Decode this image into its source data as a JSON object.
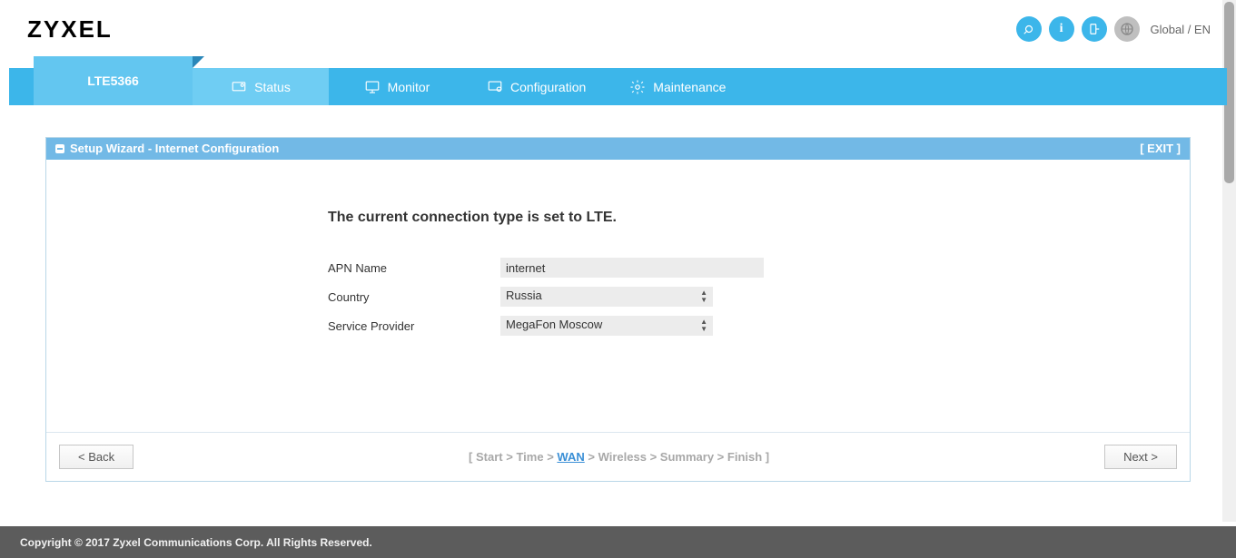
{
  "brand": "ZYXEL",
  "lang_label": "Global / EN",
  "device_tab": "LTE5366",
  "nav": {
    "status": "Status",
    "monitor": "Monitor",
    "configuration": "Configuration",
    "maintenance": "Maintenance"
  },
  "panel": {
    "title": "Setup Wizard - Internet Configuration",
    "exit": "[ EXIT ]"
  },
  "wizard": {
    "heading": "The current connection type is set to LTE.",
    "labels": {
      "apn": "APN Name",
      "country": "Country",
      "provider": "Service Provider"
    },
    "values": {
      "apn": "internet",
      "country": "Russia",
      "provider": "MegaFon Moscow"
    }
  },
  "buttons": {
    "back": "< Back",
    "next": "Next >"
  },
  "breadcrumb": {
    "open": "[ ",
    "close": " ]",
    "sep": " > ",
    "steps": {
      "start": "Start",
      "time": "Time",
      "wan": "WAN",
      "wireless": "Wireless",
      "summary": "Summary",
      "finish": "Finish"
    }
  },
  "footer": "Copyright © 2017 Zyxel Communications Corp. All Rights Reserved."
}
